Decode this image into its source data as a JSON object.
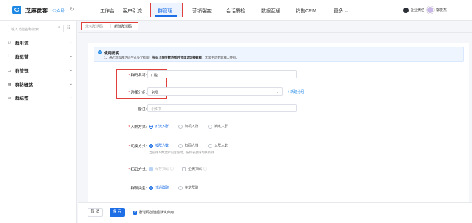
{
  "header": {
    "brand": "芝麻微客",
    "account": "公众号",
    "nav": [
      {
        "label": "工作台"
      },
      {
        "label": "客户引流"
      },
      {
        "label": "群管理"
      },
      {
        "label": "营销裂变"
      },
      {
        "label": "会话质检"
      },
      {
        "label": "数据互通"
      },
      {
        "label": "销售CRM"
      },
      {
        "label": "更多 ⌄"
      }
    ],
    "tool_label": "企业微信",
    "user_label": "郭俊杰"
  },
  "sidebar": {
    "search_placeholder": "输入功能名称搜索",
    "items": [
      {
        "label": "群引流",
        "icon": "people-icon"
      },
      {
        "label": "群运营",
        "icon": "chart-icon"
      },
      {
        "label": "群管理",
        "icon": "chat-icon"
      },
      {
        "label": "群防骚扰",
        "icon": "shield-icon"
      },
      {
        "label": "群标签",
        "icon": "tag-icon"
      }
    ]
  },
  "breadcrumb": {
    "parent": "永久群活码",
    "current": "新建群活码"
  },
  "notice": {
    "title": "使用说明",
    "text_prefix": "1、通过添加群活码生成多个群聊，",
    "text_bold": "扫码上限次数达到时会自动切换新群",
    "text_suffix": "，无需手动更新群二维码。"
  },
  "form": {
    "name_label": "群码名称:",
    "name_value": "口腔",
    "group_label": "选择分组:",
    "group_value": "全部",
    "add_group": "+ 新建分组",
    "remark_label": "备注:",
    "remark_placeholder": "小红书",
    "join_label": "入群方式:",
    "join_options": [
      "如流入群",
      "随机入群",
      "锁定入群"
    ],
    "switch_label": "切换方式:",
    "switch_options": [
      "按群人数",
      "扫码人数",
      "入群人数"
    ],
    "switch_hint": "当前群人数达到设定值时，按列表顺序切换新群",
    "scan_label": "扫码方式:",
    "scan_options": [
      "保存扫码",
      "企微扫码"
    ],
    "style_label": "群聊类型:",
    "style_options": [
      "普通群聊",
      "接龙群聊"
    ]
  },
  "footer": {
    "cancel": "取 消",
    "save": "保 存",
    "auto_pass": "群活码创建后默认启用"
  }
}
